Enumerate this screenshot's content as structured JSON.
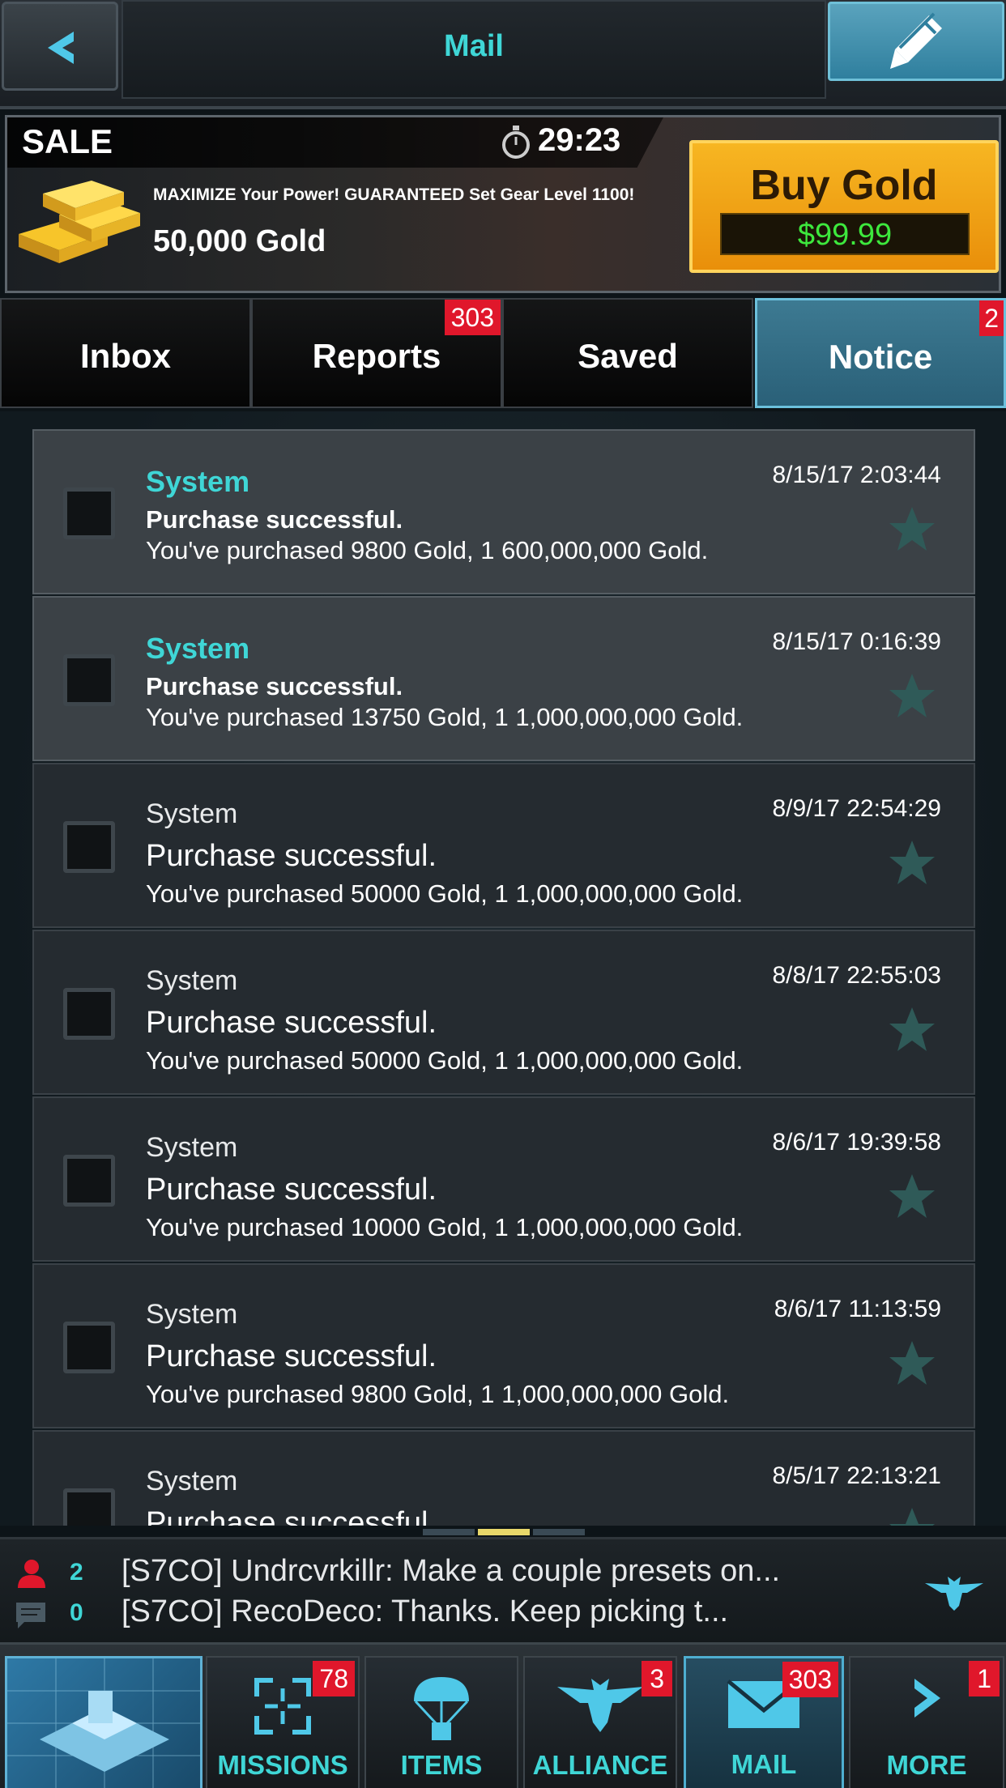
{
  "header": {
    "title": "Mail",
    "back_icon": "chevron-left-icon",
    "compose_icon": "pencil-icon"
  },
  "sale": {
    "label": "SALE",
    "timer": "29:23",
    "description": "MAXIMIZE Your Power! GUARANTEED Set Gear Level 1100!",
    "amount": "50,000 Gold",
    "buy_label": "Buy Gold",
    "price": "$99.99"
  },
  "tabs": [
    {
      "label": "Inbox",
      "badge": ""
    },
    {
      "label": "Reports",
      "badge": "303"
    },
    {
      "label": "Saved",
      "badge": ""
    },
    {
      "label": "Notice",
      "badge": "2"
    }
  ],
  "messages": [
    {
      "sender": "System",
      "subject": "Purchase successful.",
      "body": "You've purchased 9800 Gold, 1 600,000,000 Gold.",
      "date": "8/15/17 2:03:44",
      "unread": true
    },
    {
      "sender": "System",
      "subject": "Purchase successful.",
      "body": "You've purchased 13750 Gold, 1 1,000,000,000 Gold.",
      "date": "8/15/17 0:16:39",
      "unread": true
    },
    {
      "sender": "System",
      "subject": "Purchase successful.",
      "body": "You've purchased 50000 Gold, 1 1,000,000,000 Gold.",
      "date": "8/9/17 22:54:29",
      "unread": false
    },
    {
      "sender": "System",
      "subject": "Purchase successful.",
      "body": "You've purchased 50000 Gold, 1 1,000,000,000 Gold.",
      "date": "8/8/17 22:55:03",
      "unread": false
    },
    {
      "sender": "System",
      "subject": "Purchase successful.",
      "body": "You've purchased 10000 Gold, 1 1,000,000,000 Gold.",
      "date": "8/6/17 19:39:58",
      "unread": false
    },
    {
      "sender": "System",
      "subject": "Purchase successful.",
      "body": "You've purchased 9800 Gold, 1 1,000,000,000 Gold.",
      "date": "8/6/17 11:13:59",
      "unread": false
    },
    {
      "sender": "System",
      "subject": "Purchase successful.",
      "body": "",
      "date": "8/5/17 22:13:21",
      "unread": false
    }
  ],
  "chat": {
    "alliance_count": "2",
    "world_count": "0",
    "line1": "[S7CO] Undrcvrkillr: Make a couple presets on...",
    "line2": "[S7CO] RecoDeco:  Thanks.  Keep picking t..."
  },
  "nav": [
    {
      "label": "",
      "badge": "",
      "icon": "base-icon"
    },
    {
      "label": "MISSIONS",
      "badge": "78",
      "icon": "crosshair-icon"
    },
    {
      "label": "ITEMS",
      "badge": "",
      "icon": "parachute-crate-icon"
    },
    {
      "label": "ALLIANCE",
      "badge": "3",
      "icon": "eagle-icon"
    },
    {
      "label": "MAIL",
      "badge": "303",
      "icon": "envelope-icon"
    },
    {
      "label": "MORE",
      "badge": "1",
      "icon": "chevron-right-icon"
    }
  ],
  "colors": {
    "accent": "#3fd6d6",
    "badge": "#e0172b",
    "buy_button": "#f0a214",
    "price": "#3de83d",
    "active_tab": "#2f6d87"
  }
}
